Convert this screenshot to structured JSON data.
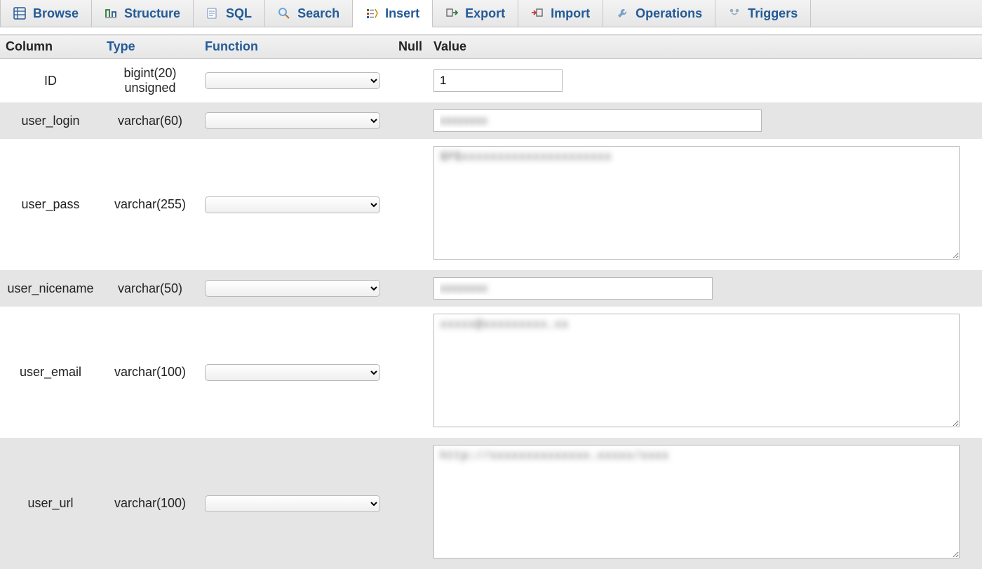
{
  "tabs": [
    {
      "id": "browse",
      "label": "Browse"
    },
    {
      "id": "structure",
      "label": "Structure"
    },
    {
      "id": "sql",
      "label": "SQL"
    },
    {
      "id": "search",
      "label": "Search"
    },
    {
      "id": "insert",
      "label": "Insert",
      "active": true
    },
    {
      "id": "export",
      "label": "Export"
    },
    {
      "id": "import",
      "label": "Import"
    },
    {
      "id": "operations",
      "label": "Operations"
    },
    {
      "id": "triggers",
      "label": "Triggers"
    }
  ],
  "headers": {
    "column": "Column",
    "type": "Type",
    "function": "Function",
    "null": "Null",
    "value": "Value"
  },
  "rows": [
    {
      "column": "ID",
      "type": "bigint(20) unsigned",
      "value": "1",
      "control": "input",
      "size_class": "w-id",
      "obscured": false
    },
    {
      "column": "user_login",
      "type": "varchar(60)",
      "value": "xxxxxxxx",
      "control": "input",
      "size_class": "w-login",
      "obscured": true
    },
    {
      "column": "user_pass",
      "type": "varchar(255)",
      "value": "$P$xxxxxxxxxxxxxxxxxxxxx",
      "control": "textarea",
      "size_class": "w-pass",
      "obscured": true
    },
    {
      "column": "user_nicename",
      "type": "varchar(50)",
      "value": "xxxxxxxx",
      "control": "input",
      "size_class": "w-nicename",
      "obscured": true
    },
    {
      "column": "user_email",
      "type": "varchar(100)",
      "value": "xxxxx@xxxxxxxxx.xx",
      "control": "textarea",
      "size_class": "w-email",
      "obscured": true
    },
    {
      "column": "user_url",
      "type": "varchar(100)",
      "value": "http://xxxxxxxxxxxxxx.xxxxx/xxxx",
      "control": "textarea",
      "size_class": "w-url",
      "obscured": true
    }
  ]
}
